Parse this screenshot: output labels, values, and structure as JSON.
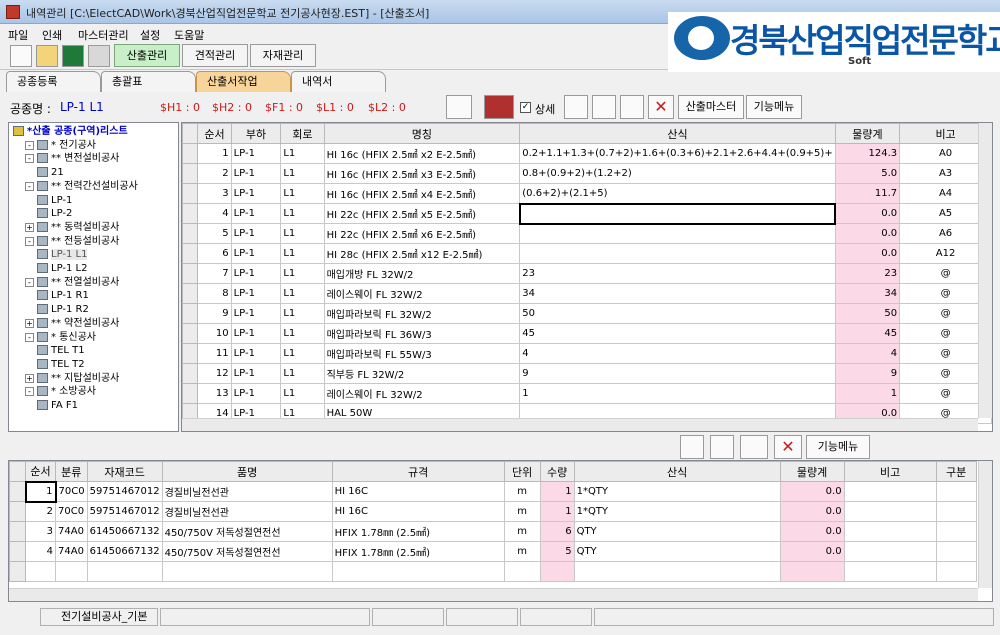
{
  "window": {
    "title": "내역관리 [C:\\ElectCAD\\Work\\경북산업직업전문학교 전기공사현장.EST] - [산출조서]"
  },
  "logo": {
    "name": "경북산업직업전문학교",
    "soft": "Soft"
  },
  "menu": [
    "파일",
    "인쇄",
    "마스터관리",
    "설정",
    "도움말"
  ],
  "toolbar": {
    "buttons": [
      "산출관리",
      "견적관리",
      "자재관리"
    ]
  },
  "tabs": [
    "공종등록",
    "총괄표",
    "산출서작업",
    "내역서"
  ],
  "info": {
    "label": "공종명 :",
    "value": "LP-1  L1",
    "h1": "$H1 : 0",
    "h2": "$H2 : 0",
    "f1": "$F1 : 0",
    "l1": "$L1 : 0",
    "l2": "$L2 : 0",
    "detail": "상세",
    "master_btn": "산출마스터",
    "func_btn": "기능메뉴"
  },
  "tree": [
    {
      "text": "*산출 공종(구역)리스트",
      "level": 0,
      "bold": true,
      "color": "#0000cc"
    },
    {
      "text": "* 전기공사",
      "level": 1,
      "exp": "-"
    },
    {
      "text": "** 변전설비공사",
      "level": 1,
      "exp": "-"
    },
    {
      "text": "21",
      "level": 2
    },
    {
      "text": "** 전력간선설비공사",
      "level": 1,
      "exp": "-"
    },
    {
      "text": "LP-1",
      "level": 2
    },
    {
      "text": "LP-2",
      "level": 2
    },
    {
      "text": "** 동력설비공사",
      "level": 1,
      "exp": "+"
    },
    {
      "text": "** 전등설비공사",
      "level": 1,
      "exp": "-"
    },
    {
      "text": "LP-1  L1",
      "level": 2,
      "selected": true
    },
    {
      "text": "LP-1  L2",
      "level": 2
    },
    {
      "text": "** 전열설비공사",
      "level": 1,
      "exp": "-"
    },
    {
      "text": "LP-1 R1",
      "level": 2
    },
    {
      "text": "LP-1  R2",
      "level": 2
    },
    {
      "text": "** 약전설비공사",
      "level": 1,
      "exp": "+"
    },
    {
      "text": "* 통신공사",
      "level": 1,
      "exp": "-"
    },
    {
      "text": "TEL T1",
      "level": 2
    },
    {
      "text": "TEL T2",
      "level": 2
    },
    {
      "text": "** 지탑설비공사",
      "level": 1,
      "exp": "+"
    },
    {
      "text": "* 소방공사",
      "level": 1,
      "exp": "-"
    },
    {
      "text": "FA F1",
      "level": 2
    }
  ],
  "grid1": {
    "headers": [
      "순서",
      "부하",
      "회로",
      "명칭",
      "산식",
      "물량계",
      "비고"
    ],
    "rows": [
      [
        "1",
        "LP-1",
        "L1",
        "HI 16c (HFIX 2.5㎟ x2 E-2.5㎟)",
        "0.2+1.1+1.3+(0.7+2)+1.6+(0.3+6)+2.1+2.6+4.4+(0.9+5)+",
        "124.3",
        "A0"
      ],
      [
        "2",
        "LP-1",
        "L1",
        "HI 16c (HFIX 2.5㎟ x3 E-2.5㎟)",
        "0.8+(0.9+2)+(1.2+2)",
        "5.0",
        "A3"
      ],
      [
        "3",
        "LP-1",
        "L1",
        "HI 16c (HFIX 2.5㎟ x4 E-2.5㎟)",
        "(0.6+2)+(2.1+5)",
        "11.7",
        "A4"
      ],
      [
        "4",
        "LP-1",
        "L1",
        "HI 22c (HFIX 2.5㎟ x5 E-2.5㎟)",
        "",
        "0.0",
        "A5"
      ],
      [
        "5",
        "LP-1",
        "L1",
        "HI 22c (HFIX 2.5㎟ x6 E-2.5㎟)",
        "",
        "0.0",
        "A6"
      ],
      [
        "6",
        "LP-1",
        "L1",
        "HI 28c (HFIX 2.5㎟ x12 E-2.5㎟)",
        "",
        "0.0",
        "A12"
      ],
      [
        "7",
        "LP-1",
        "L1",
        "매입개방 FL 32W/2",
        "23",
        "23",
        "@"
      ],
      [
        "8",
        "LP-1",
        "L1",
        "레이스웨이  FL 32W/2",
        "34",
        "34",
        "@"
      ],
      [
        "9",
        "LP-1",
        "L1",
        "매입파라보릭 FL 32W/2",
        "50",
        "50",
        "@"
      ],
      [
        "10",
        "LP-1",
        "L1",
        "매입파라보릭 FL 36W/3",
        "45",
        "45",
        "@"
      ],
      [
        "11",
        "LP-1",
        "L1",
        "매입파라보릭 FL 55W/3",
        "4",
        "4",
        "@"
      ],
      [
        "12",
        "LP-1",
        "L1",
        "직부등  FL 32W/2",
        "9",
        "9",
        "@"
      ],
      [
        "13",
        "LP-1",
        "L1",
        "레이스웨이  FL 32W/2",
        "1",
        "1",
        "@"
      ],
      [
        "14",
        "LP-1",
        "L1",
        "HAL 50W",
        "",
        "0.0",
        "@"
      ]
    ]
  },
  "mid": {
    "func_btn": "기능메뉴"
  },
  "grid2": {
    "headers": [
      "순서",
      "분류",
      "자재코드",
      "품명",
      "규격",
      "단위",
      "수량",
      "산식",
      "물량계",
      "비고",
      "구분"
    ],
    "rows": [
      [
        "1",
        "70C0",
        "59751467012",
        "경질비닐전선관",
        "HI 16C",
        "m",
        "1",
        "1*QTY",
        "0.0",
        "",
        ""
      ],
      [
        "2",
        "70C0",
        "59751467012",
        "경질비닐전선관",
        "HI 16C",
        "m",
        "1",
        "1*QTY",
        "0.0",
        "",
        ""
      ],
      [
        "3",
        "74A0",
        "61450667132",
        "450/750V 저독성절연전선",
        "HFIX 1.78㎜ (2.5㎟)",
        "m",
        "6",
        "QTY",
        "0.0",
        "",
        ""
      ],
      [
        "4",
        "74A0",
        "61450667132",
        "450/750V 저독성절연전선",
        "HFIX 1.78㎜ (2.5㎟)",
        "m",
        "5",
        "QTY",
        "0.0",
        "",
        ""
      ]
    ]
  },
  "status": {
    "text": "전기설비공사_기본"
  },
  "colors": {
    "pink": "#fbd9e6",
    "active_tab": "#f7d49a",
    "active_btn": "#c8efc8"
  }
}
